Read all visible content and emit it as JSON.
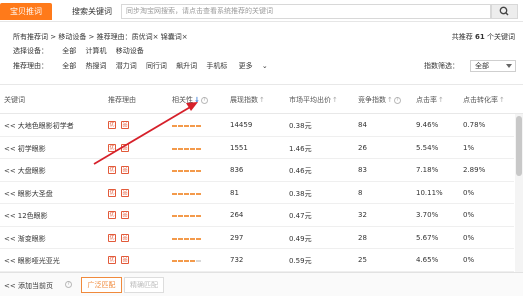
{
  "tabs": {
    "active": "宝贝推词",
    "inactive": "搜索关键词"
  },
  "search": {
    "placeholder": "同步淘宝网搜索，请点击查看系统推荐的关键词"
  },
  "breadcrumb": "所有推荐词 > 移动设备 > 推荐理由：质优词× 锦囊词×",
  "summary": {
    "prefix": "共推荐",
    "count": "61",
    "suffix": "个关键词"
  },
  "device_filter": {
    "label": "选择设备：",
    "options": [
      "全部",
      "计算机",
      "移动设备"
    ]
  },
  "reason_filter": {
    "label": "推荐理由：",
    "options": [
      "全部",
      "热搜词",
      "潜力词",
      "同行词",
      "飙升词",
      "手机标"
    ],
    "more": "更多"
  },
  "index_filter": {
    "label": "指数筛选：",
    "value": "全部"
  },
  "columns": [
    "关键词",
    "推荐理由",
    "相关性",
    "展现指数",
    "市场平均出价",
    "竞争指数",
    "点击率",
    "点击转化率"
  ],
  "rows": [
    {
      "keyword": "大地色眼影初学者",
      "badges": [
        "优",
        "品"
      ],
      "relevance": 5,
      "impressions": "14459",
      "avg_bid": "0.38元",
      "competition": "84",
      "ctr": "9.46%",
      "cvr": "0.78%"
    },
    {
      "keyword": "初学眼影",
      "badges": [
        "优",
        "品"
      ],
      "relevance": 5,
      "impressions": "1551",
      "avg_bid": "1.46元",
      "competition": "26",
      "ctr": "5.54%",
      "cvr": "1%"
    },
    {
      "keyword": "大盘眼影",
      "badges": [
        "优",
        "品"
      ],
      "relevance": 5,
      "impressions": "836",
      "avg_bid": "0.46元",
      "competition": "83",
      "ctr": "7.18%",
      "cvr": "2.89%"
    },
    {
      "keyword": "眼影大圣盘",
      "badges": [
        "优",
        "品"
      ],
      "relevance": 5,
      "impressions": "81",
      "avg_bid": "0.38元",
      "competition": "8",
      "ctr": "10.11%",
      "cvr": "0%"
    },
    {
      "keyword": "12色眼影",
      "badges": [
        "优",
        "品"
      ],
      "relevance": 5,
      "impressions": "264",
      "avg_bid": "0.47元",
      "competition": "32",
      "ctr": "3.70%",
      "cvr": "0%"
    },
    {
      "keyword": "渐变眼影",
      "badges": [
        "优",
        "品"
      ],
      "relevance": 5,
      "impressions": "297",
      "avg_bid": "0.49元",
      "competition": "28",
      "ctr": "5.67%",
      "cvr": "0%"
    },
    {
      "keyword": "眼影哑光亚光",
      "badges": [
        "优",
        "品"
      ],
      "relevance": 4,
      "impressions": "732",
      "avg_bid": "0.59元",
      "competition": "25",
      "ctr": "4.65%",
      "cvr": "0%"
    }
  ],
  "footer": {
    "add_label": "添加当前页",
    "broad_match": "广泛匹配",
    "exact_match": "精确匹配"
  },
  "colors": {
    "accent": "#ff7a1a",
    "badge": "#e25a3a",
    "arrow": "#d6202a",
    "bar": "#f39a4b"
  }
}
